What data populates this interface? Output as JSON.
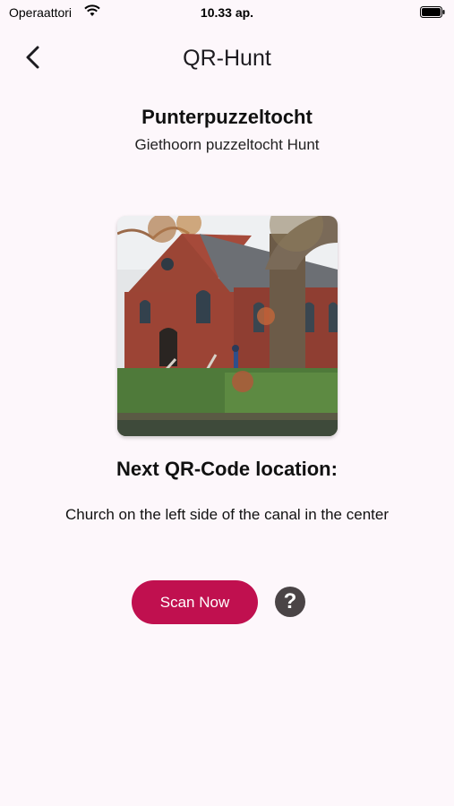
{
  "status_bar": {
    "carrier": "Operaattori",
    "time": "10.33 ap.",
    "icons": [
      "wifi-icon",
      "battery-icon"
    ]
  },
  "nav": {
    "back_icon": "chevron-left-icon",
    "title": "QR-Hunt"
  },
  "hunt": {
    "title": "Punterpuzzeltocht",
    "subtitle": "Giethoorn puzzeltocht Hunt"
  },
  "location": {
    "photo": "church-photo",
    "heading": "Next QR-Code location:",
    "description": "Church on the left side of the canal in the center"
  },
  "actions": {
    "scan_label": "Scan Now",
    "help_icon": "question-mark-icon",
    "help_glyph": "?"
  },
  "colors": {
    "background": "#fdf7fb",
    "accent": "#c0104f",
    "help": "#4a4446"
  }
}
